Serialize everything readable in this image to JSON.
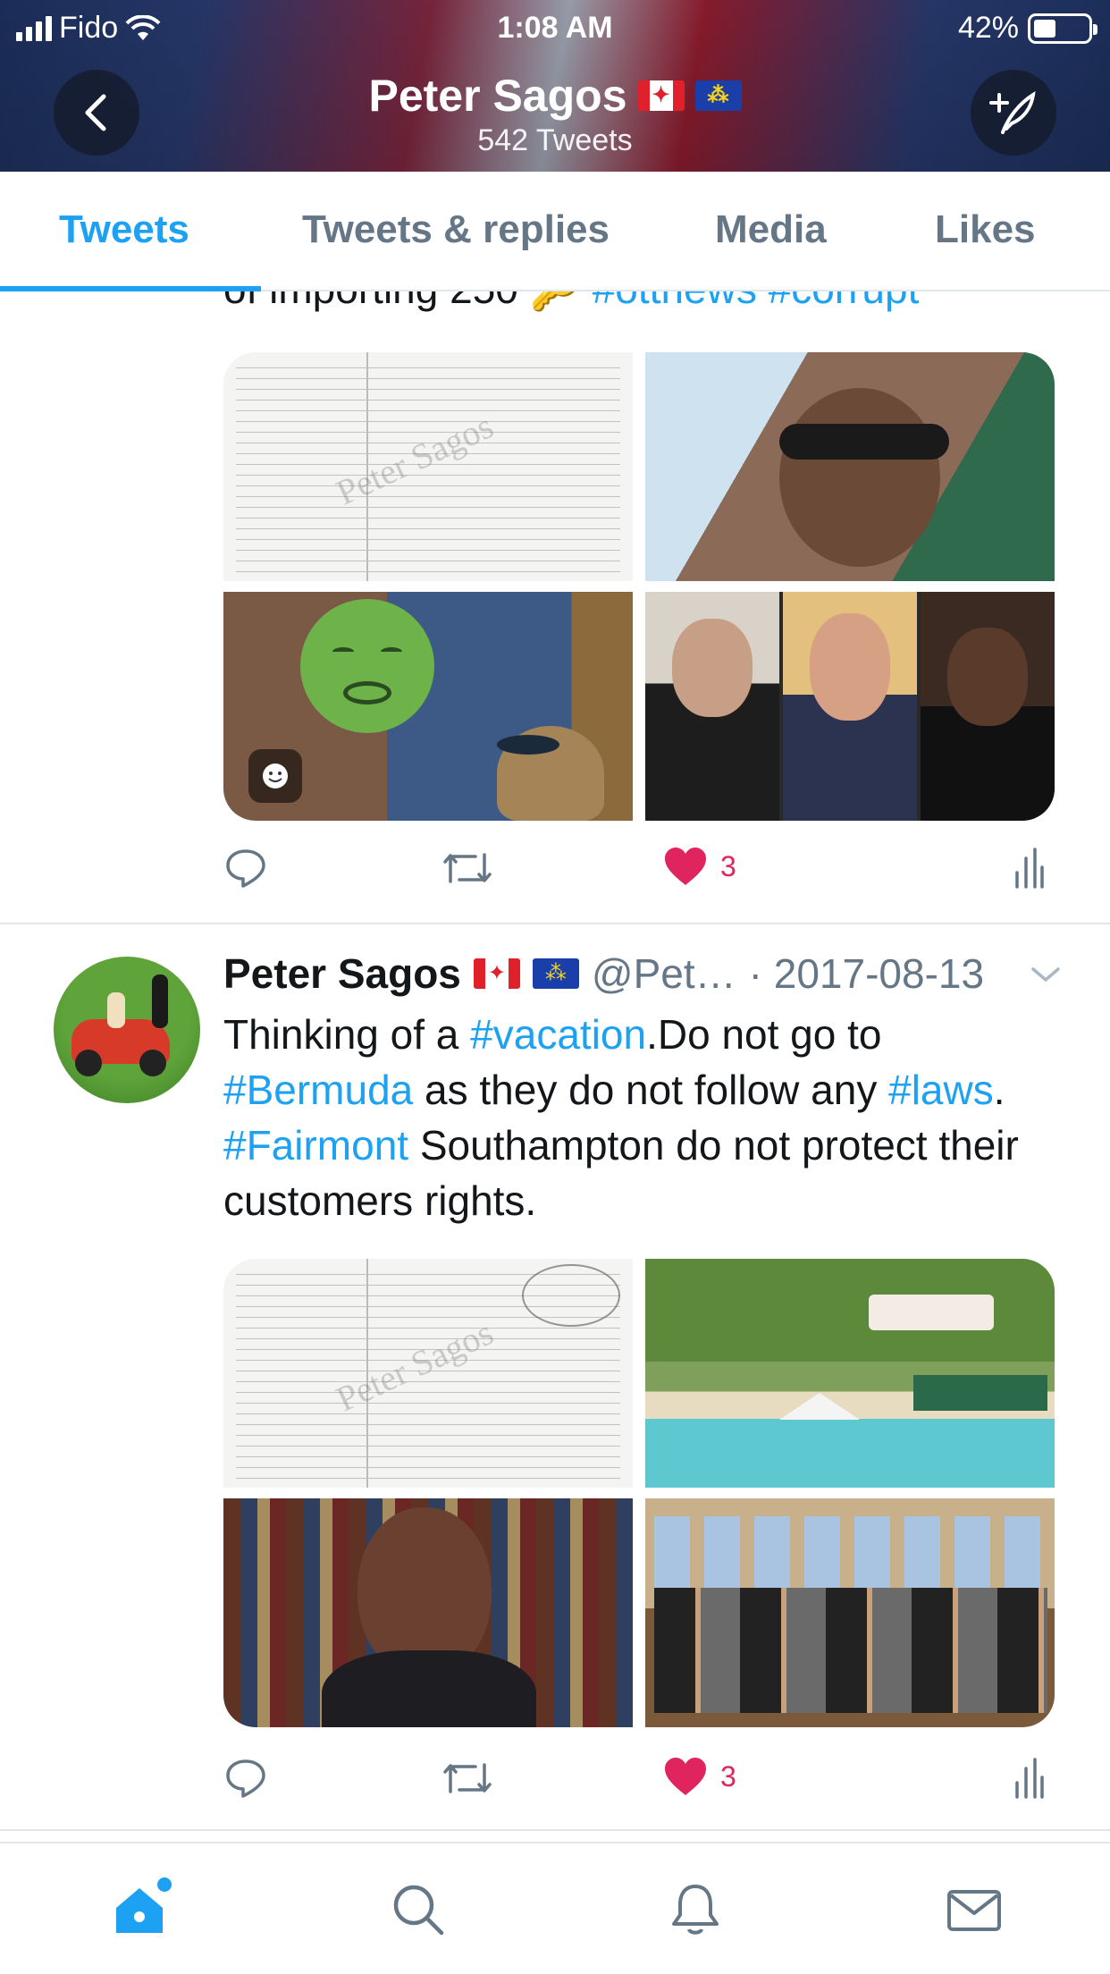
{
  "status_bar": {
    "carrier": "Fido",
    "time": "1:08 AM",
    "battery": "42%",
    "battery_level": 0.42
  },
  "header": {
    "name": "Peter Sagos",
    "tweet_count": "542 Tweets"
  },
  "tabs": [
    {
      "label": "Tweets",
      "active": true
    },
    {
      "label": "Tweets & replies",
      "active": false
    },
    {
      "label": "Media",
      "active": false
    },
    {
      "label": "Likes",
      "active": false
    }
  ],
  "tweet1": {
    "partial_text": "of importing 250",
    "partial_tags": "#ottnews #corrupt",
    "doc_watermark": "Peter Sagos",
    "likes": "3"
  },
  "tweet2": {
    "name": "Peter Sagos",
    "handle": "@Pet…",
    "date": "· 2017-08-13",
    "text_parts": {
      "p1": "Thinking of a ",
      "t1": "#vacation",
      "p2": ".Do not go to ",
      "t2": "#Bermuda",
      "p3": " as they do not follow any ",
      "t3": "#laws",
      "p4": ". ",
      "t4": "#Fairmont",
      "p5": " Southampton do not protect their customers rights."
    },
    "doc_watermark": "Peter Sagos",
    "likes": "3"
  },
  "colors": {
    "accent": "#1da1f2",
    "like": "#e0245e",
    "secondary": "#657786"
  },
  "icons": [
    "back-arrow-icon",
    "compose-tweet-icon",
    "reply-icon",
    "retweet-icon",
    "heart-icon",
    "analytics-icon",
    "home-icon",
    "search-icon",
    "bell-icon",
    "mail-icon",
    "chevron-down-icon"
  ]
}
